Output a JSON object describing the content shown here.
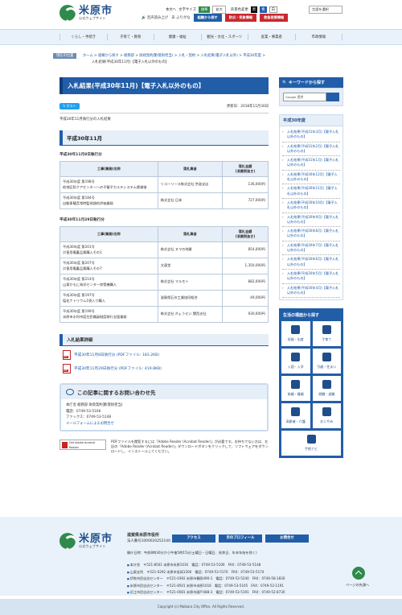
{
  "header": {
    "logo_name": "米原市",
    "logo_sub": "公式ウェブサイト",
    "links": [
      "本文へ"
    ],
    "font_size_label": "文字サイズ",
    "font_standard": "標準",
    "font_large": "拡大",
    "bg_color_label": "背景色変更",
    "bg_black": "黒",
    "bg_blue": "青",
    "bg_white": "白",
    "language_select": "言語を選択",
    "read_aloud": "音声読み上げ",
    "furigana": "ふりがな",
    "btn_find": "組織から探す",
    "btn_disaster": "防災・気象情報",
    "btn_emergency": "救急医療情報"
  },
  "gnav": [
    "くらし・手続き",
    "子育て・教育",
    "健康・福祉",
    "観光・文化・スポーツ",
    "産業・事業者",
    "市政情報"
  ],
  "breadcrumb": {
    "label": "現在の位置",
    "items": [
      "ホーム",
      "組織から探す",
      "総務部",
      "財政契約課(管財担当)",
      "入札・契約",
      "入札結果(電子入札以外)",
      "平成30年度"
    ],
    "current": "入札結果(平成30年11月)【電子入札以外のもの】"
  },
  "main": {
    "title": "入札結果(平成30年11月)【電子入札以外のもの】",
    "tweet": "ポスト",
    "updated": "更新日：2018年11月30日",
    "intro": "平成30年11月執行分の入札結果",
    "section_title": "平成30年11月",
    "table1": {
      "heading": "平成30年11月8日執行分",
      "headers": [
        "工事(業務)名称",
        "落札業者",
        "落札金額\n(消費税抜き)"
      ],
      "rows": [
        {
          "name1": "平成30年度 第198号",
          "name2": "他地区防クアセンターへの子電子カルテシステム賃貸借",
          "vendor": "リコーリース株式会社 京滋支店",
          "amount": "136,000円"
        },
        {
          "name1": "平成30年度 第184号",
          "name2": "自動車騒音常時監視調的評価業務",
          "vendor": "株式会社 日本",
          "amount": "727,000円"
        }
      ]
    },
    "table2": {
      "heading": "平成30年11月29日執行分",
      "headers": [
        "工事(業務)名称",
        "落札業者",
        "落札金額\n(消費税抜き)"
      ],
      "rows": [
        {
          "name1": "平成30年度 第201号",
          "name2": "災害用備蓄品素購入その1",
          "vendor": "株式会社 ヌマの地業",
          "amount": "854,000円"
        },
        {
          "name1": "平成30年度 第207号",
          "name2": "災害用備蓄品素購入その7",
          "vendor": "文連堂",
          "amount": "1,350,000円"
        },
        {
          "name1": "平成30年度 第214号",
          "name2": "山東かもに海洋センター除雪機購入",
          "vendor": "株式会社 マルモト",
          "amount": "882,000円"
        },
        {
          "name1": "平成30年度 第197号",
          "name2": "塩化ナトリウム1袋入り購入",
          "vendor": "滋賀県石灰工業協同組合",
          "amount": "49,000円"
        },
        {
          "name1": "平成30年度 第199号",
          "name2": "米原市水利市度住民職員制度移行支援業務",
          "vendor": "株式会社 ぎょうせい 関西支社",
          "amount": "930,000円"
        }
      ]
    },
    "detail_title": "入札結果詳細",
    "pdfs": [
      "平成30年11月8日執行分 (PDFファイル: 183.2KB)",
      "平成30年11月29日執行分 (PDFファイル: 419.8KB)"
    ],
    "contact_title": "この記事に関するお問い合わせ先",
    "contact_lines": [
      "本庁舎 総務部 財政契約課(管財担当)",
      "電話：0749-53-5166",
      "ファックス：0749-53-5148",
      "メールフォームによるお問合せ"
    ],
    "acrobat_badge": "Get Adobe Acrobat Reader",
    "acrobat_text": "PDFファイルを閲覧するには「Adobe Reader (Acrobat Reader)」が必要です。お持ちでない方は、左記の「Adobe Reader (Acrobat Reader)」ダウンロードボタンをクリックして、ソフトウェアをダウンロードし、インストールしてください。"
  },
  "sidebar": {
    "search_title": "キーワードから探す",
    "search_placeholder": "Google 提供",
    "year_title": "平成30年度",
    "year_items": [
      "入札結果(平成31年3月)【電子入札以外のもの】",
      "入札結果(平成31年2月)【電子入札以外のもの】",
      "入札結果(平成31年1月)【電子入札以外のもの】",
      "入札結果(平成30年12月)【電子入札以外のもの】",
      "入札結果(平成30年11月)【電子入札以外のもの】",
      "入札結果(平成30年10月)【電子入札以外のもの】",
      "入札結果(平成30年9月)【電子入札以外のもの】",
      "入札結果(平成30年8月)【電子入札以外のもの】",
      "入札結果(平成30年7月)【電子入札以外のもの】",
      "入札結果(平成30年6月)【電子入札以外のもの】",
      "入札結果(平成30年5月)【電子入札以外のもの】",
      "入札結果(平成30年4月)【電子入札以外のもの】"
    ],
    "life_title": "生活の場面から探す",
    "life_items": [
      "妊娠・出産",
      "子育て",
      "入園・入学",
      "引越・住まい",
      "結婚・離婚",
      "就職・退職",
      "高齢者・介護",
      "おくやみ",
      "手続ナビ"
    ]
  },
  "footer": {
    "org_name": "滋賀県米原市役所",
    "org_no": "法人番号1000020252140",
    "btn_access": "アクセス",
    "btn_profile": "市のプロフィール",
    "btn_inquiry": "お問合せ",
    "hours": "開庁日時：午前8時30分から午後5時15分(土曜日・日曜日、祝休日、年末年始を除く)",
    "offices": [
      "本庁舎　〒521-8501 米原市米原1016　電話：0749-53-5100　FAX：0749-53-5148",
      "山東支所　〒521-0292 米原市長岡1206　電話：0749-53-5170　FAX：0749-53-5174",
      "伊吹市民自治センター　〒521-0392 米原市春照490-1　電話：0749-53-5240　FAX：0749-58-1830",
      "米原市民自治センター　〒521-8501 米原市米原1016　電話：0749-53-5165　FAX：0749-52-1191",
      "近江市民自治センター　〒521-0081 米原市顔戸488-3　電話：0749-53-5191　FAX：0749-52-8730"
    ],
    "pagetop": "ページの先頭へ",
    "copyright": "Copyright (c) Maibara City Office. All Rights Reserved."
  }
}
